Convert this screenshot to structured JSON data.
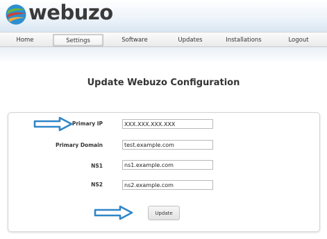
{
  "brand": {
    "name": "webuzo",
    "colors": {
      "mark_green": "#6bb33a",
      "mark_red": "#d23f31",
      "mark_blue": "#2c8fd0",
      "mark_orange": "#f2a93b"
    }
  },
  "nav": {
    "items": [
      {
        "label": "Home",
        "active": false
      },
      {
        "label": "Settings",
        "active": true
      },
      {
        "label": "Software",
        "active": false
      },
      {
        "label": "Updates",
        "active": false
      },
      {
        "label": "Installations",
        "active": false
      },
      {
        "label": "Logout",
        "active": false
      }
    ]
  },
  "page": {
    "title": "Update Webuzo Configuration"
  },
  "form": {
    "primary_ip": {
      "label": "Primary IP",
      "value": "XXX.XXX.XXX.XXX"
    },
    "primary_domain": {
      "label": "Primary Domain",
      "value": "test.example.com"
    },
    "ns1": {
      "label": "NS1",
      "value": "ns1.example.com"
    },
    "ns2": {
      "label": "NS2",
      "value": "ns2.example.com"
    },
    "submit_label": "Update"
  },
  "annotations": {
    "arrow_color": "#2e86c8",
    "arrows": [
      {
        "points_to": "primary-ip-label",
        "icon": "right-arrow-icon"
      },
      {
        "points_to": "update-button",
        "icon": "right-arrow-icon"
      }
    ]
  }
}
